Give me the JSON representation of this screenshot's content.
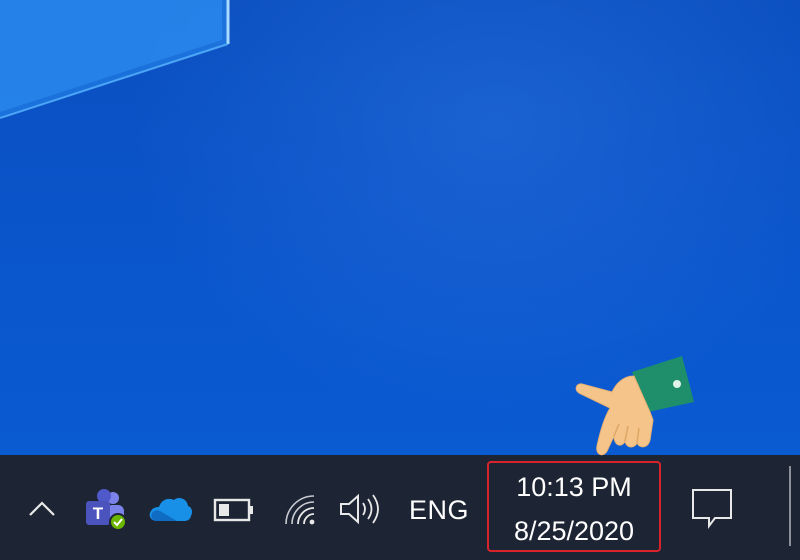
{
  "desktop": {
    "background_color": "#0a52c6"
  },
  "taskbar": {
    "background_color": "#1d2433",
    "tray": {
      "chevron_icon": "chevron-up-icon",
      "icons": [
        "teams-icon",
        "onedrive-icon",
        "battery-icon",
        "network-icon",
        "volume-icon"
      ],
      "language": "ENG"
    },
    "clock": {
      "time": "10:13 PM",
      "date": "8/25/2020",
      "highlight_color": "#d9232c"
    },
    "action_center_icon": "notification-icon"
  },
  "annotation": {
    "pointer_icon": "pointing-hand-icon"
  }
}
